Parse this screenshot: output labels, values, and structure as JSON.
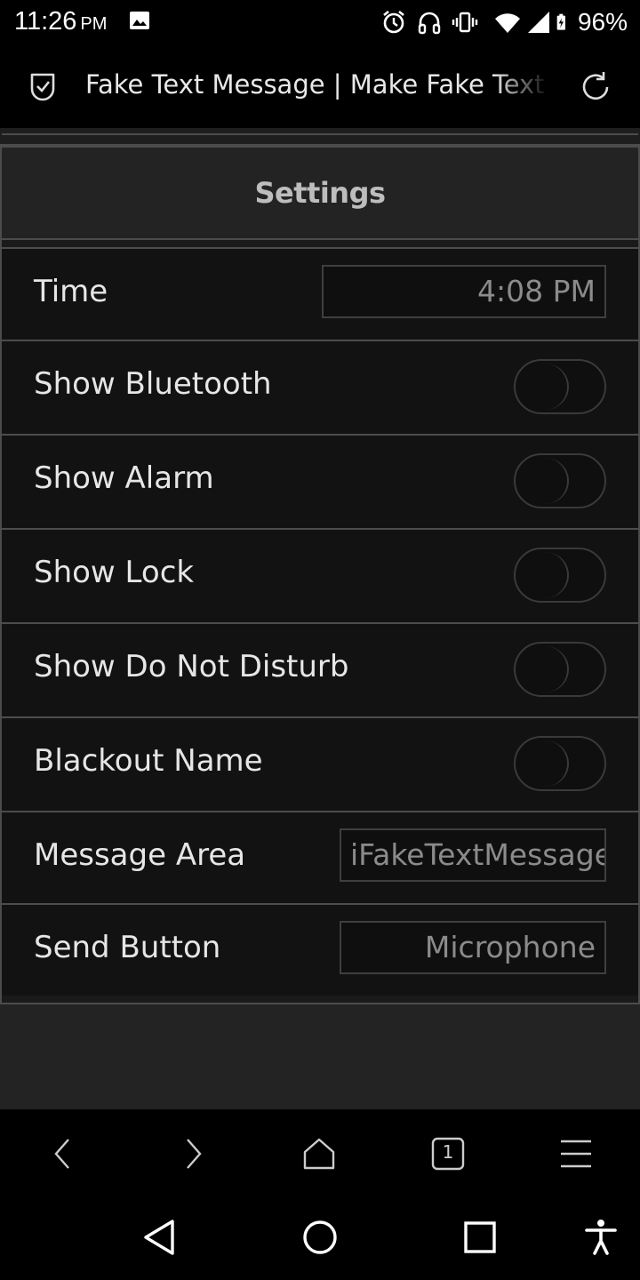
{
  "status_bar": {
    "time": "11:26",
    "ampm": "PM",
    "battery": "96%",
    "icons": [
      "gallery-icon",
      "alarm-icon",
      "headphones-icon",
      "vibrate-icon",
      "wifi-icon",
      "signal-icon",
      "battery-charging-icon"
    ]
  },
  "browser": {
    "page_title": "Fake Text Message | Make Fake Text",
    "tab_count": "1"
  },
  "settings": {
    "title": "Settings",
    "rows": [
      {
        "label": "Time",
        "type": "text",
        "value": "4:08 PM"
      },
      {
        "label": "Show Bluetooth",
        "type": "toggle",
        "on": false
      },
      {
        "label": "Show Alarm",
        "type": "toggle",
        "on": false
      },
      {
        "label": "Show Lock",
        "type": "toggle",
        "on": false
      },
      {
        "label": "Show Do Not Disturb",
        "type": "toggle",
        "on": false
      },
      {
        "label": "Blackout Name",
        "type": "toggle",
        "on": false
      },
      {
        "label": "Message Area",
        "type": "text",
        "value": "iFakeTextMessage"
      },
      {
        "label": "Send Button",
        "type": "text",
        "value": "Microphone"
      }
    ]
  }
}
